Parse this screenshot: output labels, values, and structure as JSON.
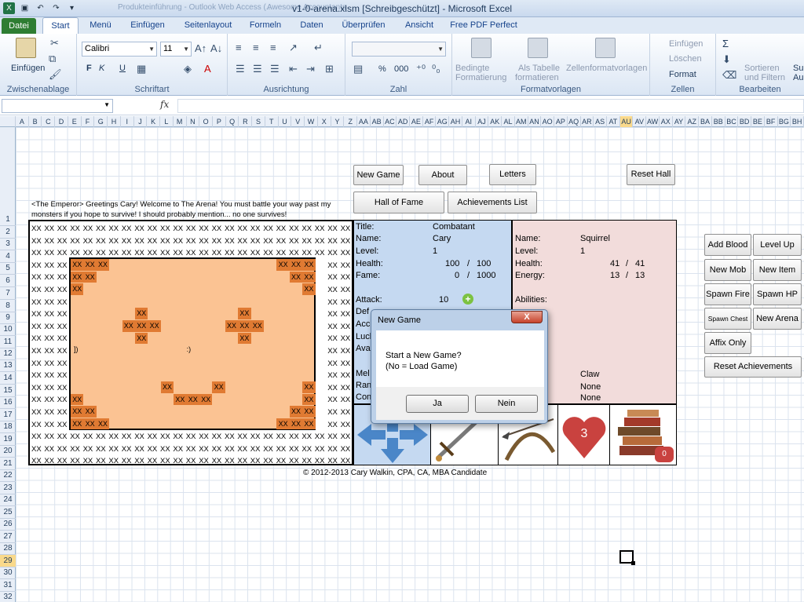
{
  "window": {
    "title": "v1-0-arena.xlsm  [Schreibgeschützt]  -  Microsoft Excel",
    "ghost_tab_1": "Produkteinführung - Outlook Web Access (...",
    "ghost_tab_2": "Awesome Accountants"
  },
  "ribbon_tabs": [
    "Datei",
    "Start",
    "Menü",
    "Einfügen",
    "Seitenlayout",
    "Formeln",
    "Daten",
    "Überprüfen",
    "Ansicht",
    "Free PDF Perfect"
  ],
  "ribbon": {
    "clipboard": {
      "paste": "Einfügen",
      "label": "Zwischenablage"
    },
    "font": {
      "name": "Calibri",
      "size": "11",
      "bold": "F",
      "italic": "K",
      "underline": "U",
      "label": "Schriftart"
    },
    "alignment": {
      "label": "Ausrichtung"
    },
    "number": {
      "label": "Zahl",
      "percent": "%",
      "thousands": "000"
    },
    "styles": {
      "conditional": "Bedingte",
      "conditional2": "Formatierung",
      "table": "Als Tabelle",
      "table2": "formatieren",
      "cell": "Zellenformatvorlagen",
      "label": "Formatvorlagen"
    },
    "cells": {
      "insert": "Einfügen",
      "delete": "Löschen",
      "format": "Format",
      "label": "Zellen"
    },
    "editing": {
      "sum": "Σ",
      "sort": "Sortieren",
      "sort2": "und Filtern",
      "find": "Su",
      "find2": "Au",
      "label": "Bearbeiten"
    }
  },
  "formula_bar": {
    "fx": "fx"
  },
  "columns": [
    "A",
    "B",
    "C",
    "D",
    "E",
    "F",
    "G",
    "H",
    "I",
    "J",
    "K",
    "L",
    "M",
    "N",
    "O",
    "P",
    "Q",
    "R",
    "S",
    "T",
    "U",
    "V",
    "W",
    "X",
    "Y",
    "Z",
    "AA",
    "AB",
    "AC",
    "AD",
    "AE",
    "AF",
    "AG",
    "AH",
    "AI",
    "AJ",
    "AK",
    "AL",
    "AM",
    "AN",
    "AO",
    "AP",
    "AQ",
    "AR",
    "AS",
    "AT",
    "AU",
    "AV",
    "AW",
    "AX",
    "AY",
    "AZ",
    "BA",
    "BB",
    "BC",
    "BD",
    "BE",
    "BF",
    "BG",
    "BH"
  ],
  "selected_column": "AU",
  "rows": [
    "1",
    "2",
    "3",
    "4",
    "5",
    "6",
    "7",
    "8",
    "9",
    "10",
    "11",
    "12",
    "13",
    "14",
    "15",
    "16",
    "17",
    "18",
    "19",
    "20",
    "21",
    "22",
    "23",
    "24",
    "25",
    "26",
    "27",
    "28",
    "29",
    "30",
    "31",
    "32"
  ],
  "selected_row": "29",
  "buttons": {
    "new_game": "New Game",
    "about": "About",
    "letters": "Letters",
    "reset_hall": "Reset Hall",
    "hall_of_fame": "Hall of Fame",
    "achievements_list": "Achievements List",
    "add_blood": "Add Blood",
    "level_up": "Level Up",
    "new_mob": "New Mob",
    "new_item": "New Item",
    "spawn_fire": "Spawn Fire",
    "spawn_hp": "Spawn HP",
    "spawn_chest": "Spawn Chest",
    "new_arena": "New Arena",
    "affix_only": "Affix Only",
    "reset_achievements": "Reset Achievements"
  },
  "message": "<The Emperor> Greetings Cary! Welcome to The Arena! You must battle your way past my monsters if you hope to survive! I should probably mention... no one survives!",
  "arena": {
    "cell": "XX",
    "face_left": "])",
    "face_right": ":)"
  },
  "player": {
    "title_label": "Title:",
    "title": "Combatant",
    "name_label": "Name:",
    "name": "Cary",
    "level_label": "Level:",
    "level": "1",
    "health_label": "Health:",
    "health": "100",
    "health_max": "100",
    "fame_label": "Fame:",
    "fame": "0",
    "fame_max": "1000",
    "attack_label": "Attack:",
    "attack": "10",
    "def_label": "Def",
    "acc_label": "Accu",
    "luck_label": "Luck",
    "avail_label": "Avai",
    "melee_label": "Mel",
    "ranged_label": "Ran",
    "con_label": "Con",
    "slash": "/"
  },
  "mob": {
    "name_label": "Name:",
    "name": "Squirrel",
    "level_label": "Level:",
    "level": "1",
    "health_label": "Health:",
    "health": "41",
    "health_max": "41",
    "energy_label": "Energy:",
    "energy": "13",
    "energy_max": "13",
    "abilities_label": "Abilities:",
    "ability1": "Claw",
    "ability2": "None",
    "ability3": "None",
    "slash": "/"
  },
  "tiles": {
    "hearts": "3",
    "books": "0"
  },
  "copyright": "© 2012-2013 Cary Walkin, CPA, CA, MBA Candidate",
  "dialog": {
    "title": "New Game",
    "close": "X",
    "line1": "Start a New Game?",
    "line2": "(No = Load Game)",
    "yes": "Ja",
    "no": "Nein"
  }
}
